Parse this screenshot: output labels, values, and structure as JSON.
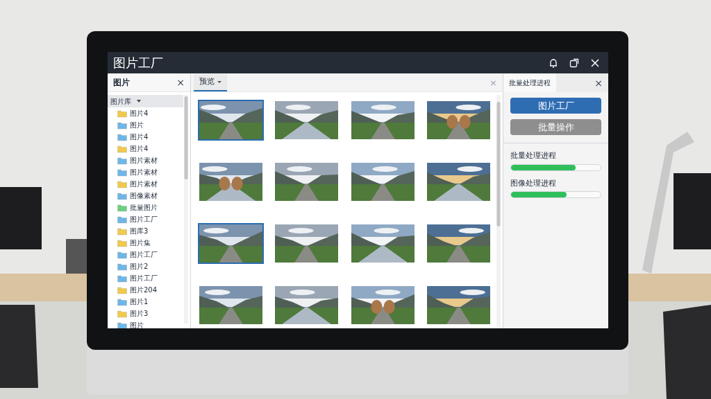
{
  "window": {
    "title": "图片工厂"
  },
  "sidebar": {
    "title": "图片",
    "close": "×",
    "tree": [
      {
        "label": "图片库",
        "expanded": true,
        "selected": true,
        "children": [
          {
            "label": "图片4",
            "color": "#f2c94c"
          },
          {
            "label": "图片",
            "color": "#6fb6e6"
          },
          {
            "label": "图片4",
            "color": "#6fb6e6"
          },
          {
            "label": "图片4",
            "color": "#f2c94c"
          },
          {
            "label": "图片素材",
            "color": "#6fb6e6"
          },
          {
            "label": "图片素材",
            "color": "#6fb6e6"
          },
          {
            "label": "图片素材",
            "color": "#f2c94c"
          },
          {
            "label": "图像素材",
            "color": "#6fb6e6"
          },
          {
            "label": "批量图片",
            "color": "#6fcf7f"
          },
          {
            "label": "图片工厂",
            "color": "#6fb6e6"
          },
          {
            "label": "图库3",
            "color": "#f2c94c"
          },
          {
            "label": "图片集",
            "color": "#f2c94c"
          },
          {
            "label": "图片工厂",
            "color": "#6fb6e6"
          },
          {
            "label": "图片2",
            "color": "#6fb6e6"
          },
          {
            "label": "图片工厂",
            "color": "#6fb6e6"
          },
          {
            "label": "图片204",
            "color": "#f2c94c"
          },
          {
            "label": "图片1",
            "color": "#6fb6e6"
          },
          {
            "label": "图片3",
            "color": "#f2c94c"
          },
          {
            "label": "图片",
            "color": "#6fb6e6"
          }
        ]
      }
    ]
  },
  "preview": {
    "tabs": [
      {
        "label": "预览",
        "selected": true
      }
    ],
    "close": "×",
    "thumbnails": [
      {
        "selected": true
      },
      {
        "selected": false
      },
      {
        "selected": false
      },
      {
        "selected": false
      },
      {
        "selected": false
      },
      {
        "selected": false
      },
      {
        "selected": false
      },
      {
        "selected": false
      },
      {
        "selected": true
      },
      {
        "selected": false
      },
      {
        "selected": false
      },
      {
        "selected": false
      },
      {
        "selected": false
      },
      {
        "selected": false
      },
      {
        "selected": false
      },
      {
        "selected": false
      }
    ]
  },
  "batch_panel": {
    "tab": "批量处理进程",
    "close": "×",
    "buttons": [
      {
        "label": "图片工厂",
        "disabled": false
      },
      {
        "label": "批量操作",
        "disabled": true
      }
    ],
    "progress": [
      {
        "label": "批量处理进程",
        "level": 0.72
      },
      {
        "label": "图像处理进程",
        "level": 0.62
      }
    ]
  }
}
